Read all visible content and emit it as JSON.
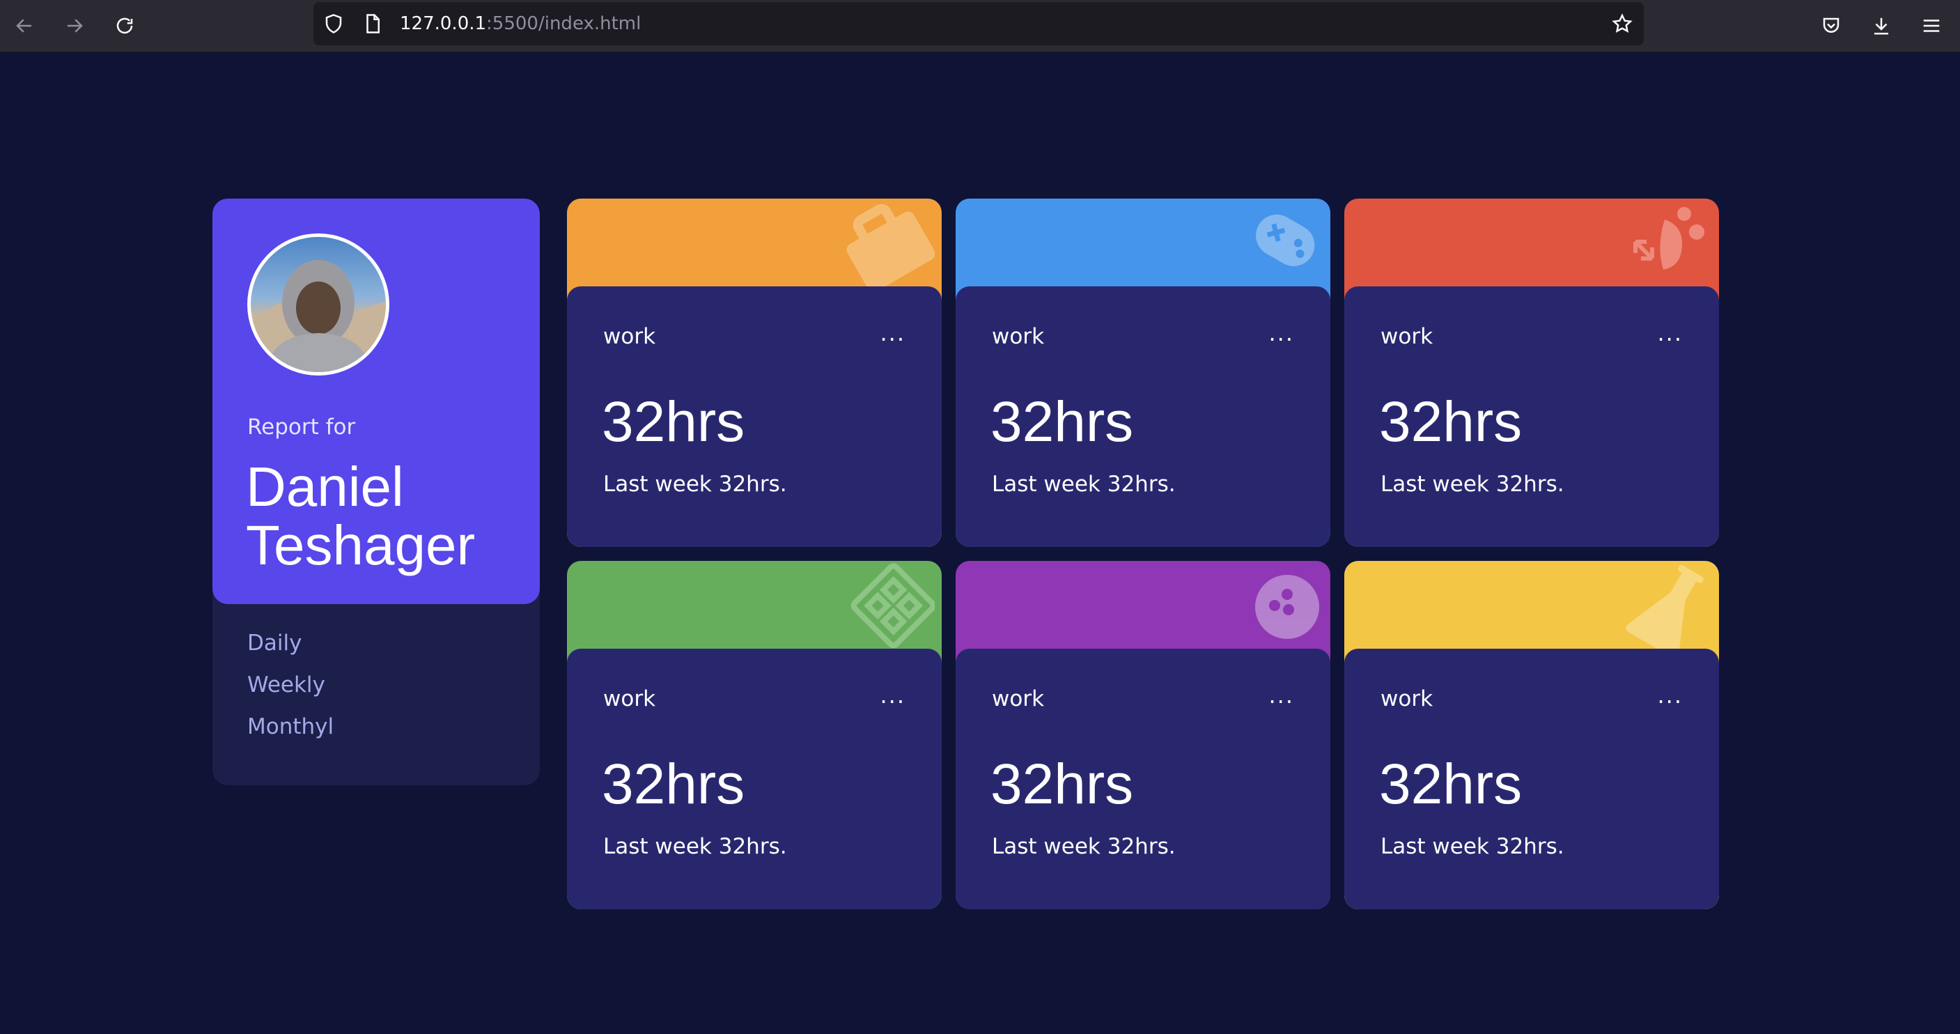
{
  "browser": {
    "url_host": "127.0.0.1",
    "url_path": ":5500/index.html"
  },
  "profile": {
    "report_label": "Report for",
    "name": "Daniel Teshager",
    "periods": [
      "Daily",
      "Weekly",
      "Monthyl"
    ]
  },
  "cards": [
    {
      "title": "work",
      "menu": "...",
      "hours": "32hrs",
      "previous": "Last week 32hrs.",
      "color": "#f1a03c",
      "icon": "briefcase-icon"
    },
    {
      "title": "work",
      "menu": "...",
      "hours": "32hrs",
      "previous": "Last week 32hrs.",
      "color": "#4595ec",
      "icon": "gamepad-icon"
    },
    {
      "title": "work",
      "menu": "...",
      "hours": "32hrs",
      "previous": "Last week 32hrs.",
      "color": "#e05540",
      "icon": "study-icon"
    },
    {
      "title": "work",
      "menu": "...",
      "hours": "32hrs",
      "previous": "Last week 32hrs.",
      "color": "#66ae5c",
      "icon": "exercise-icon"
    },
    {
      "title": "work",
      "menu": "...",
      "hours": "32hrs",
      "previous": "Last week 32hrs.",
      "color": "#8f37b4",
      "icon": "bowling-ball-icon"
    },
    {
      "title": "work",
      "menu": "...",
      "hours": "32hrs",
      "previous": "Last week 32hrs.",
      "color": "#f4c645",
      "icon": "flask-icon"
    }
  ]
}
